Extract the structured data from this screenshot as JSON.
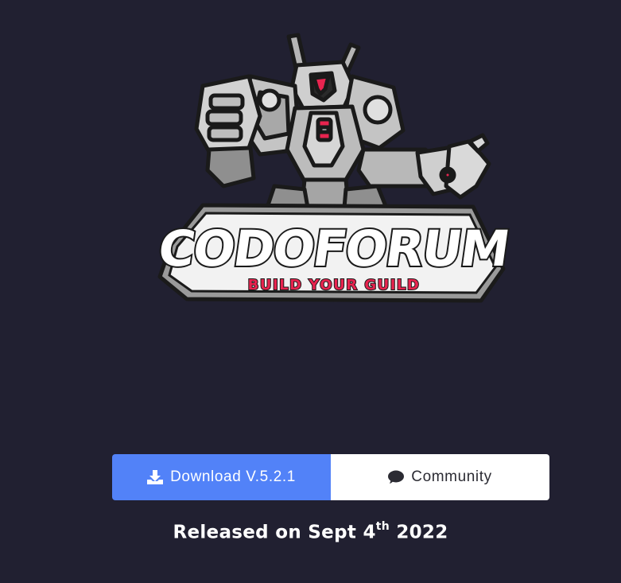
{
  "logo": {
    "wordmark": "CODOFORUM",
    "tagline": "BUILD YOUR GUILD",
    "colors": {
      "accent": "#e8244f",
      "metal_light": "#c9c9c9",
      "metal_mid": "#9a9a9a",
      "outline": "#1a1a1a"
    }
  },
  "actions": {
    "download_label": "Download V.5.2.1",
    "download_icon": "download-icon",
    "community_label": "Community",
    "community_icon": "chat-bubble-icon"
  },
  "release": {
    "prefix": "Released on Sept 4",
    "suffix": "th",
    "year": " 2022"
  },
  "colors": {
    "background": "#212031",
    "download_button": "#5282f8",
    "community_button": "#ffffff"
  }
}
